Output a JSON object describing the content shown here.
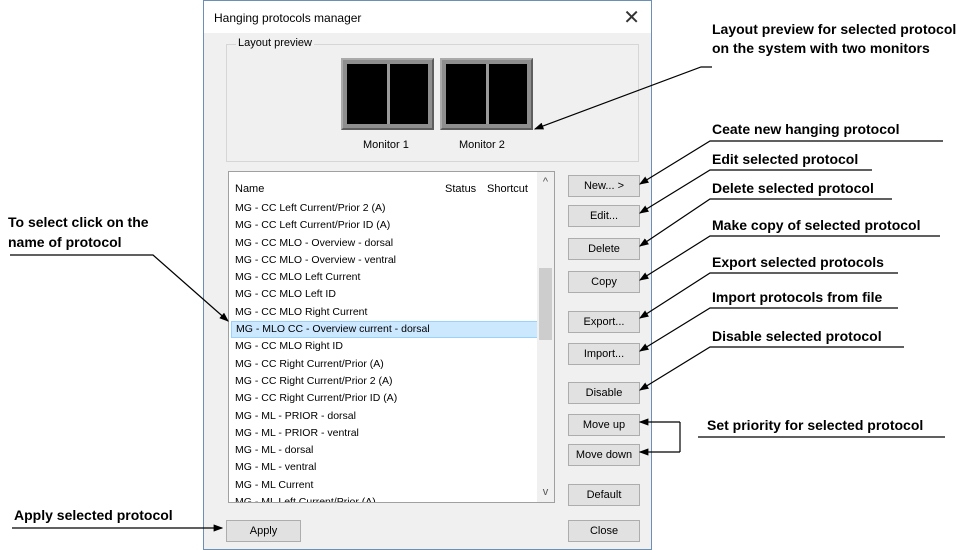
{
  "dialog": {
    "title": "Hanging protocols manager",
    "close_glyph": "✕",
    "layout_group_label": "Layout preview",
    "monitors": [
      "Monitor 1",
      "Monitor 2"
    ]
  },
  "list": {
    "columns": [
      "Name",
      "Status",
      "Shortcut"
    ],
    "selected_index": 7,
    "items": [
      "MG - CC Left Current/Prior 2 (A)",
      "MG - CC Left Current/Prior ID (A)",
      "MG - CC MLO - Overview - dorsal",
      "MG - CC MLO - Overview - ventral",
      "MG - CC MLO Left Current",
      "MG - CC MLO Left ID",
      "MG - CC MLO Right Current",
      "MG - MLO CC - Overview current - dorsal",
      "MG - CC MLO Right ID",
      "MG - CC Right Current/Prior (A)",
      "MG - CC Right Current/Prior 2 (A)",
      "MG - CC Right Current/Prior ID (A)",
      "MG - ML - PRIOR - dorsal",
      "MG - ML - PRIOR - ventral",
      "MG - ML - dorsal",
      "MG - ML - ventral",
      "MG - ML Current",
      "MG - ML Left Current/Prior (A)"
    ],
    "scroll_up": "^",
    "scroll_down": "v"
  },
  "buttons": {
    "new": "New...  >",
    "edit": "Edit...",
    "delete": "Delete",
    "copy": "Copy",
    "export": "Export...",
    "import": "Import...",
    "disable": "Disable",
    "move_up": "Move up",
    "move_down": "Move down",
    "default": "Default",
    "apply": "Apply",
    "close": "Close"
  },
  "annotations": {
    "layout_preview_1": "Layout preview for selected protocol",
    "layout_preview_2": "on the system with two monitors",
    "new": "Ceate new hanging protocol",
    "edit": "Edit selected protocol",
    "delete": "Delete selected protocol",
    "copy": "Make copy of selected protocol",
    "export": "Export selected protocols",
    "import": "Import protocols from file",
    "disable": "Disable selected protocol",
    "priority": "Set priority for selected protocol",
    "select_1": "To select click on the",
    "select_2": "name of protocol",
    "apply": "Apply selected protocol"
  }
}
